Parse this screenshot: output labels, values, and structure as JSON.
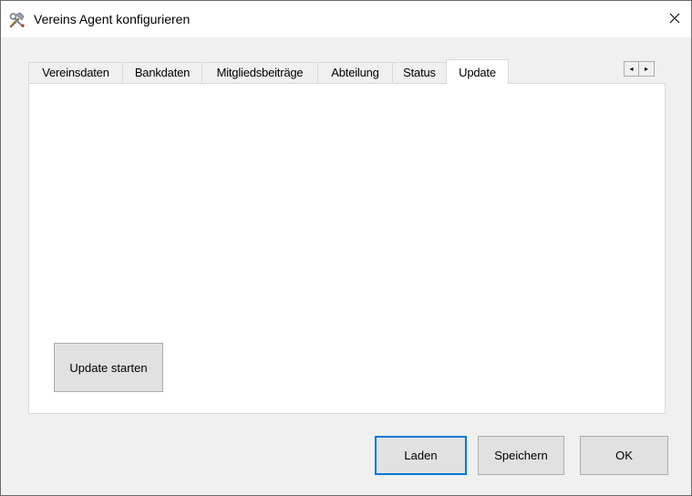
{
  "window": {
    "title": "Vereins Agent konfigurieren",
    "icon": "tools-icon",
    "close_glyph": "✕"
  },
  "tabs": [
    {
      "label": "Vereinsdaten",
      "active": false
    },
    {
      "label": "Bankdaten",
      "active": false
    },
    {
      "label": "Mitgliedsbeiträge",
      "active": false
    },
    {
      "label": "Abteilung",
      "active": false
    },
    {
      "label": "Status",
      "active": false
    },
    {
      "label": "Update",
      "active": true
    }
  ],
  "tab_scroll": {
    "left": "◂",
    "right": "▸"
  },
  "panel": {
    "update_button": "Update starten"
  },
  "footer": {
    "load_button": "Laden",
    "save_button": "Speichern",
    "ok_button": "OK"
  },
  "colors": {
    "default_button_border": "#0078d7",
    "button_face": "#e1e1e1",
    "dialog_bg": "#f0f0f0"
  }
}
